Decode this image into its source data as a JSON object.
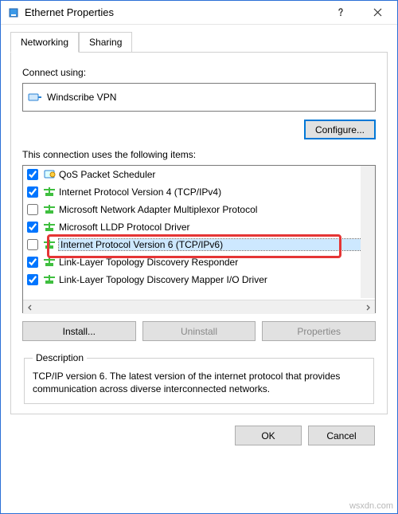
{
  "window": {
    "title": "Ethernet Properties"
  },
  "tabs": {
    "networking": "Networking",
    "sharing": "Sharing"
  },
  "connect_using_label": "Connect using:",
  "adapter_name": "Windscribe VPN",
  "configure_btn": "Configure...",
  "items_label": "This connection uses the following items:",
  "items": [
    {
      "checked": true,
      "icon": "qos",
      "label": "QoS Packet Scheduler"
    },
    {
      "checked": true,
      "icon": "proto",
      "label": "Internet Protocol Version 4 (TCP/IPv4)"
    },
    {
      "checked": false,
      "icon": "proto",
      "label": "Microsoft Network Adapter Multiplexor Protocol"
    },
    {
      "checked": true,
      "icon": "proto",
      "label": "Microsoft LLDP Protocol Driver"
    },
    {
      "checked": false,
      "icon": "proto",
      "label": "Internet Protocol Version 6 (TCP/IPv6)",
      "selected": true
    },
    {
      "checked": true,
      "icon": "proto",
      "label": "Link-Layer Topology Discovery Responder"
    },
    {
      "checked": true,
      "icon": "proto",
      "label": "Link-Layer Topology Discovery Mapper I/O Driver"
    }
  ],
  "buttons": {
    "install": "Install...",
    "uninstall": "Uninstall",
    "properties": "Properties"
  },
  "description": {
    "legend": "Description",
    "text": "TCP/IP version 6. The latest version of the internet protocol that provides communication across diverse interconnected networks."
  },
  "footer": {
    "ok": "OK",
    "cancel": "Cancel"
  },
  "watermark": "wsxdn.com"
}
